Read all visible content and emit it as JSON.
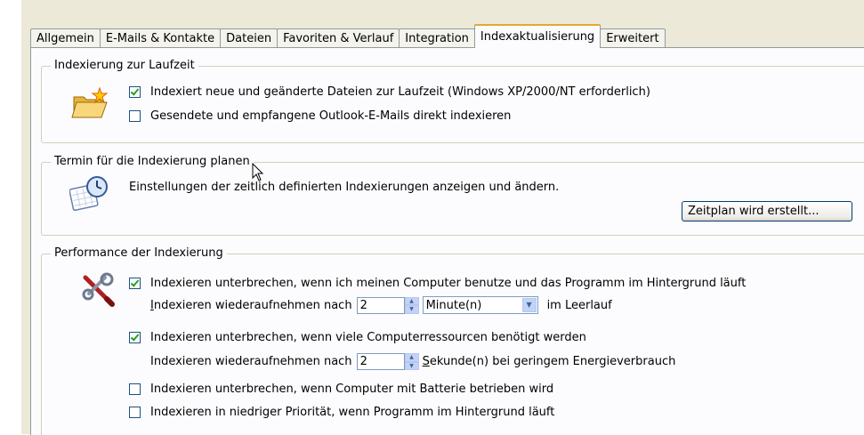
{
  "tabs": [
    {
      "label": "Allgemein",
      "active": false
    },
    {
      "label": "E-Mails & Kontakte",
      "active": false
    },
    {
      "label": "Dateien",
      "active": false
    },
    {
      "label": "Favoriten & Verlauf",
      "active": false
    },
    {
      "label": "Integration",
      "active": false
    },
    {
      "label": "Indexaktualisierung",
      "active": true
    },
    {
      "label": "Erweitert",
      "active": false
    }
  ],
  "runtime": {
    "legend": "Indexierung zur Laufzeit",
    "icon": "folder-star-icon",
    "opt1": {
      "label": "Indexiert neue und geänderte Dateien zur Laufzeit (Windows XP/2000/NT erforderlich)",
      "checked": true
    },
    "opt2": {
      "label": "Gesendete und empfangene Outlook-E-Mails direkt indexieren",
      "checked": false
    }
  },
  "schedule": {
    "legend": "Termin für die Indexierung planen",
    "icon": "calendar-clock-icon",
    "description": "Einstellungen der zeitlich definierten Indexierungen anzeigen und ändern.",
    "button": "Zeitplan wird erstellt..."
  },
  "performance": {
    "legend": "Performance der Indexierung",
    "icon": "tools-icon",
    "opt1": {
      "label": "Indexieren unterbrechen, wenn ich meinen Computer benutze und das Programm im Hintergrund läuft",
      "checked": true
    },
    "resume1": {
      "prefix_first": "I",
      "prefix_rest": "ndexieren wiederaufnehmen nach",
      "value": "2",
      "unit": "Minute(n)",
      "suffix": "im Leerlauf"
    },
    "opt2": {
      "label": "Indexieren unterbrechen, wenn viele Computerressourcen benötigt werden",
      "checked": true
    },
    "resume2": {
      "prefix": "Indexieren wiederaufnehmen nach",
      "value": "2",
      "unit_first": "S",
      "unit_rest": "ekunde(n) bei geringem Energieverbrauch"
    },
    "opt3": {
      "label": "Indexieren unterbrechen, wenn Computer mit Batterie betrieben wird",
      "checked": false
    },
    "opt4": {
      "label": "Indexieren in niedriger Priorität, wenn Programm im Hintergrund läuft",
      "checked": false
    }
  }
}
